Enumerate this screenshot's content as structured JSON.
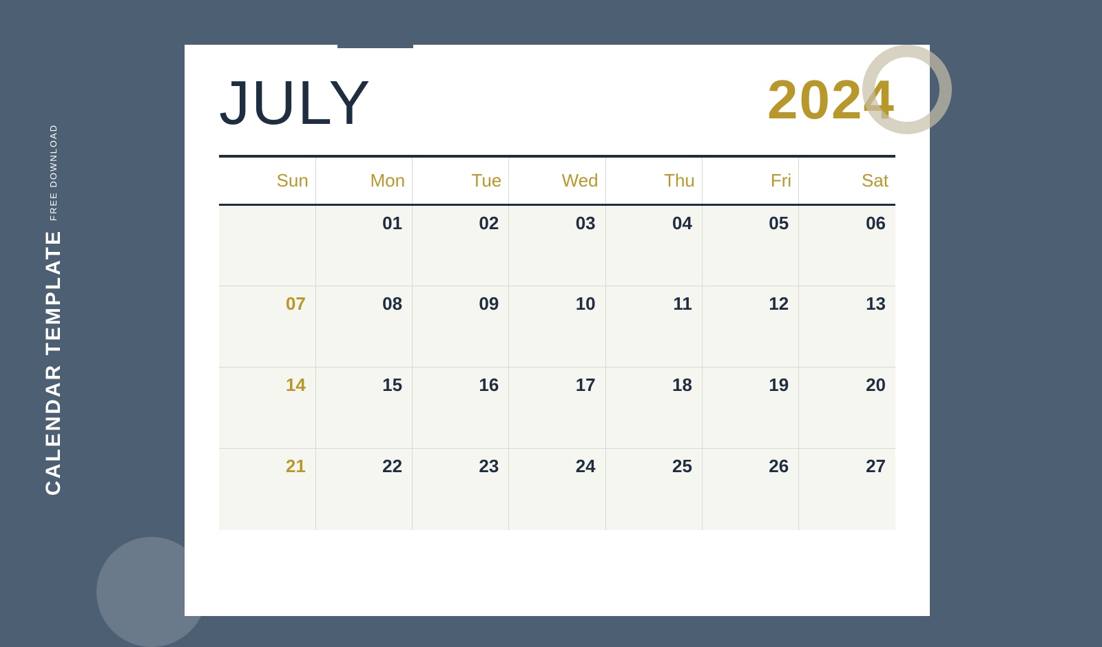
{
  "sidebar": {
    "free_download": "FREE DOWNLOAD",
    "calendar_template": "CALENDAR TEMPLATE"
  },
  "calendar": {
    "month": "JULY",
    "year": "2024",
    "days_of_week": [
      "Sun",
      "Mon",
      "Tue",
      "Wed",
      "Thu",
      "Fri",
      "Sat"
    ],
    "weeks": [
      [
        "",
        "01",
        "02",
        "03",
        "04",
        "05",
        "06"
      ],
      [
        "07",
        "08",
        "09",
        "10",
        "11",
        "12",
        "13"
      ],
      [
        "14",
        "15",
        "16",
        "17",
        "18",
        "19",
        "20"
      ],
      [
        "21",
        "22",
        "23",
        "24",
        "25",
        "26",
        "27"
      ]
    ],
    "colors": {
      "background": "#4d5f73",
      "calendar_bg": "#ffffff",
      "month_color": "#1e2d40",
      "year_color": "#b8982a",
      "day_header_color": "#b8982a",
      "day_number_color": "#1e2d40",
      "sunday_color": "#b8982a",
      "cell_bg": "#f5f6f0",
      "divider_color": "#1e2d40",
      "border_color": "#d5dbd0"
    }
  }
}
